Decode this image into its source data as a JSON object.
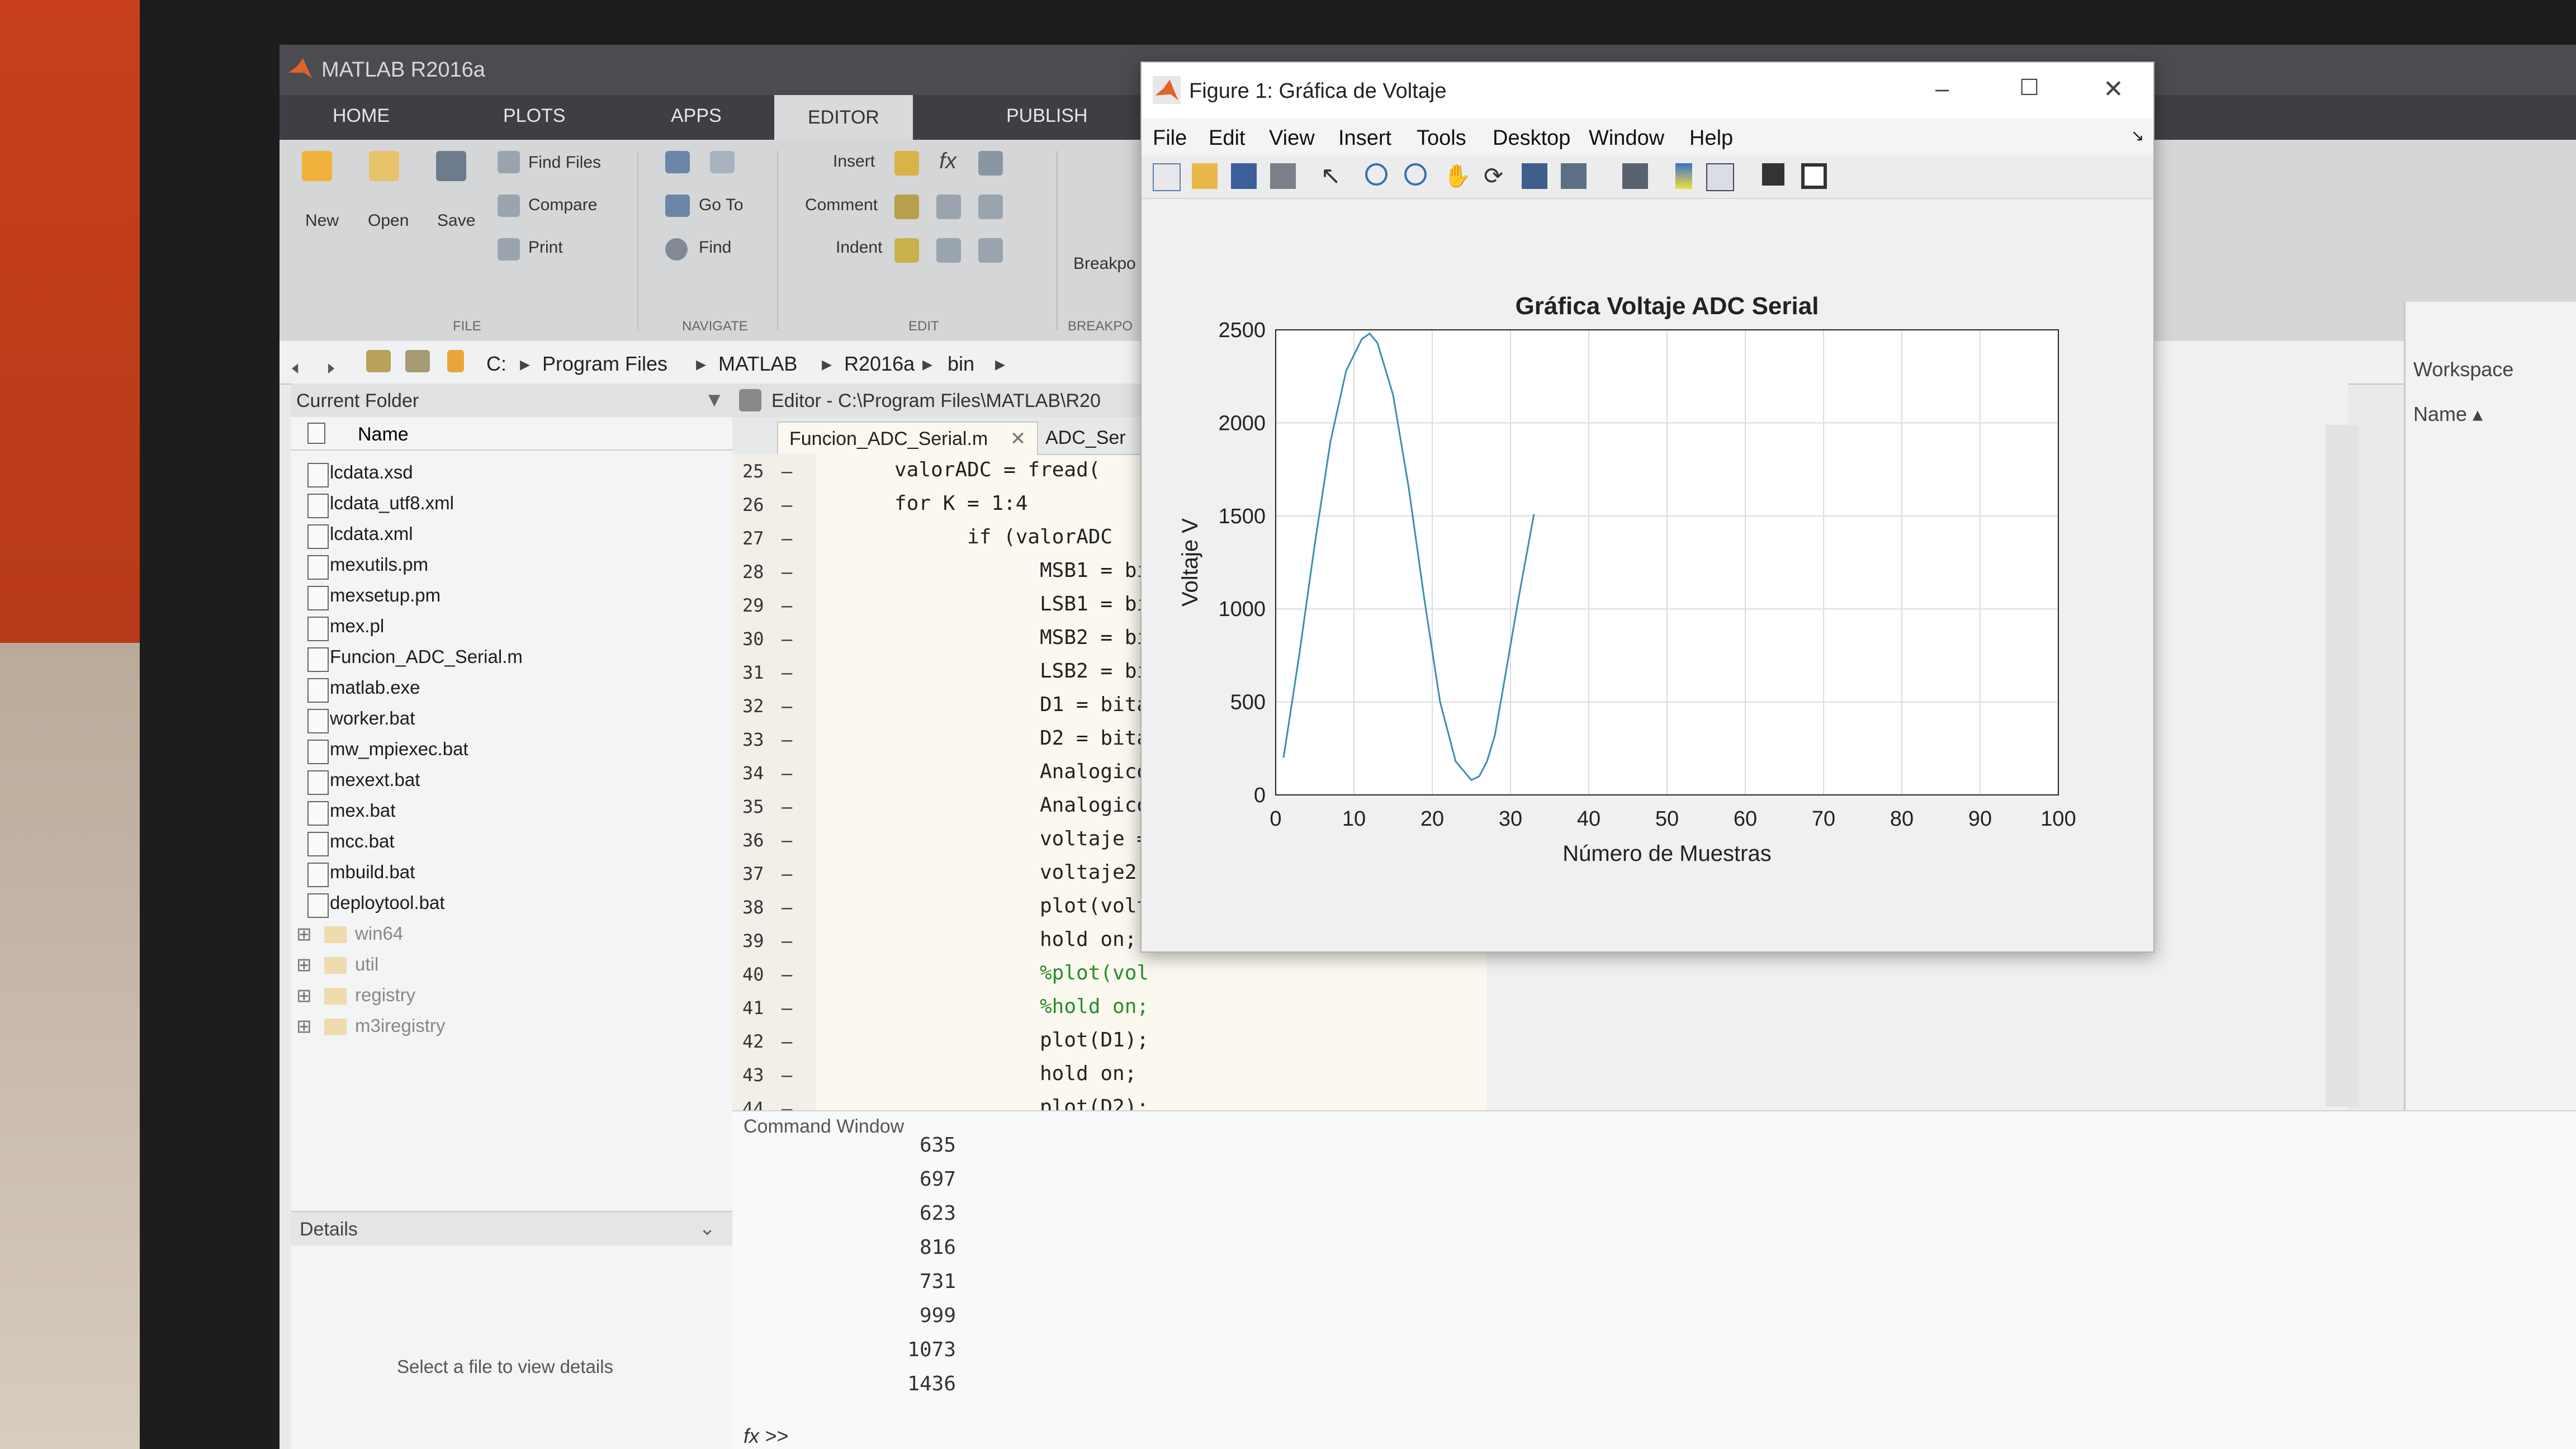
{
  "matlab": {
    "title": "MATLAB R2016a",
    "tabs": [
      "HOME",
      "PLOTS",
      "APPS",
      "EDITOR",
      "PUBLISH"
    ],
    "ribbon": {
      "new": "New",
      "open": "Open",
      "save": "Save",
      "find_files": "Find Files",
      "compare": "Compare",
      "print": "Print",
      "go_to": "Go To",
      "find": "Find",
      "insert": "Insert",
      "comment": "Comment",
      "indent": "Indent",
      "breakpoints": "Breakpo",
      "sections": {
        "file": "FILE",
        "navigate": "NAVIGATE",
        "edit": "EDIT",
        "breakpoints": "BREAKPO"
      }
    },
    "path": [
      "C:",
      "Program Files",
      "MATLAB",
      "R2016a",
      "bin"
    ],
    "current_folder": {
      "title": "Current Folder",
      "name_header": "Name",
      "files": [
        "lcdata.xsd",
        "lcdata_utf8.xml",
        "lcdata.xml",
        "mexutils.pm",
        "mexsetup.pm",
        "mex.pl",
        "Funcion_ADC_Serial.m",
        "matlab.exe",
        "worker.bat",
        "mw_mpiexec.bat",
        "mexext.bat",
        "mex.bat",
        "mcc.bat",
        "mbuild.bat",
        "deploytool.bat"
      ],
      "folders": [
        "win64",
        "util",
        "registry",
        "m3iregistry"
      ],
      "details_title": "Details",
      "details_message": "Select a file to view details"
    },
    "editor": {
      "title": "Editor - C:\\Program Files\\MATLAB\\R20",
      "tabs": [
        "Funcion_ADC_Serial.m",
        "ADC_Ser"
      ],
      "lines": [
        {
          "n": "25",
          "code": "valorADC = fread("
        },
        {
          "n": "26",
          "code": "for K = 1:4"
        },
        {
          "n": "27",
          "code": "if (valorADC"
        },
        {
          "n": "28",
          "code": "MSB1 = bi"
        },
        {
          "n": "29",
          "code": "LSB1 = bi"
        },
        {
          "n": "30",
          "code": "MSB2 = bi"
        },
        {
          "n": "31",
          "code": "LSB2 = bi"
        },
        {
          "n": "32",
          "code": "D1 = bita"
        },
        {
          "n": "33",
          "code": "D2 = bita"
        },
        {
          "n": "34",
          "code": "Analogico"
        },
        {
          "n": "35",
          "code": "Analogico"
        },
        {
          "n": "36",
          "code": "voltaje ="
        },
        {
          "n": "37",
          "code": "voltaje2"
        },
        {
          "n": "38",
          "code": "plot(volt"
        },
        {
          "n": "39",
          "code": "hold on;"
        },
        {
          "n": "40",
          "code": "%plot(vol"
        },
        {
          "n": "41",
          "code": "%hold on;"
        },
        {
          "n": "42",
          "code": "plot(D1);"
        },
        {
          "n": "43",
          "code": "hold on;"
        },
        {
          "n": "44",
          "code": "plot(D2);"
        }
      ]
    },
    "command_window": {
      "title": "Command Window",
      "values": [
        "635",
        "697",
        "623",
        "816",
        "731",
        "999",
        "1073",
        "1436"
      ],
      "prompt": "fx >>"
    },
    "workspace": {
      "title": "Workspace",
      "name_header": "Name ▴"
    }
  },
  "figure": {
    "title": "Figure 1: Gráfica de Voltaje",
    "menus": [
      "File",
      "Edit",
      "View",
      "Insert",
      "Tools",
      "Desktop",
      "Window",
      "Help"
    ]
  },
  "chart_data": {
    "type": "line",
    "title": "Gráfica Voltaje ADC Serial",
    "xlabel": "Número de Muestras",
    "ylabel": "Voltaje V",
    "xlim": [
      0,
      100
    ],
    "ylim": [
      0,
      2500
    ],
    "xticks": [
      0,
      10,
      20,
      30,
      40,
      50,
      60,
      70,
      80,
      90,
      100
    ],
    "yticks": [
      0,
      500,
      1000,
      1500,
      2000,
      2500
    ],
    "grid": true,
    "color": "#3a8fb5",
    "series": [
      {
        "x": [
          1,
          3,
          5,
          7,
          9,
          11,
          12,
          13,
          15,
          17,
          19,
          21,
          23,
          25,
          26,
          27,
          28,
          29,
          31,
          33
        ],
        "y": [
          200,
          750,
          1350,
          1900,
          2280,
          2450,
          2480,
          2430,
          2150,
          1650,
          1050,
          500,
          180,
          80,
          100,
          180,
          320,
          560,
          1050,
          1510
        ]
      }
    ]
  }
}
